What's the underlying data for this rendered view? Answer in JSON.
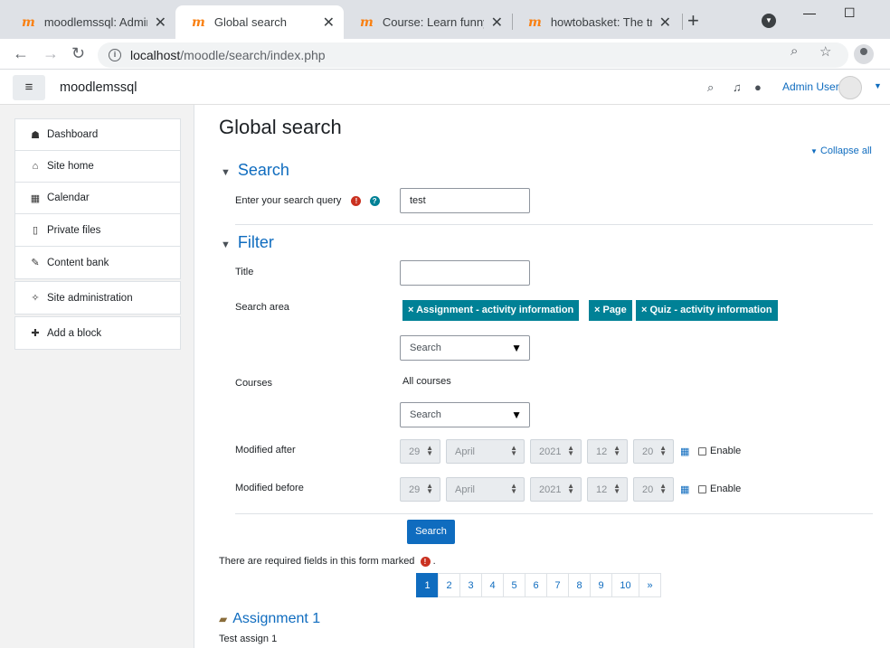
{
  "browser": {
    "tabs": [
      {
        "title": "moodlemssql: Administ",
        "active": false
      },
      {
        "title": "Global search",
        "active": true
      },
      {
        "title": "Course: Learn funny m",
        "active": false
      },
      {
        "title": "howtobasket: The trian",
        "active": false
      }
    ],
    "favicon_glyph": "m",
    "new_tab": "+",
    "url_host": "localhost",
    "url_path": "/moodle/search/index.php",
    "info_glyph": "i"
  },
  "navbar": {
    "site_name": "moodlemssql",
    "hamburger": "≡",
    "user_name": "Admin User"
  },
  "drawer": {
    "groups": [
      {
        "items": [
          {
            "label": "Dashboard",
            "icon": "☗"
          },
          {
            "label": "Site home",
            "icon": "⌂"
          },
          {
            "label": "Calendar",
            "icon": "▦"
          },
          {
            "label": "Private files",
            "icon": "▯"
          }
        ]
      },
      {
        "items": [
          {
            "label": "Content bank",
            "icon": "✎"
          }
        ]
      },
      {
        "items": [
          {
            "label": "Site administration",
            "icon": "✧"
          }
        ]
      },
      {
        "items": [
          {
            "label": "Add a block",
            "icon": "✚"
          }
        ]
      }
    ]
  },
  "main": {
    "title": "Global search",
    "collapse_all": "Collapse all",
    "search_section": {
      "heading": "Search",
      "query_label": "Enter your search query",
      "query_value": "test"
    },
    "filter_section": {
      "heading": "Filter",
      "title_label": "Title",
      "title_value": "",
      "search_area_label": "Search area",
      "search_area_tags": [
        "× Assignment - activity information",
        "× Page",
        "× Quiz - activity information"
      ],
      "search_area_placeholder": "Search",
      "courses_label": "Courses",
      "courses_value": "All courses",
      "courses_placeholder": "Search",
      "modified_after_label": "Modified after",
      "modified_before_label": "Modified before",
      "date_after": {
        "day": "29",
        "month": "April",
        "year": "2021",
        "hour": "12",
        "minute": "20"
      },
      "date_before": {
        "day": "29",
        "month": "April",
        "year": "2021",
        "hour": "12",
        "minute": "20"
      },
      "enable_label": "Enable"
    },
    "submit_label": "Search",
    "required_note": "There are required fields in this form marked",
    "required_note_end": ".",
    "pagination": [
      "1",
      "2",
      "3",
      "4",
      "5",
      "6",
      "7",
      "8",
      "9",
      "10",
      "»"
    ],
    "active_page": "1",
    "result": {
      "title": "Assignment 1",
      "description": "Test assign 1"
    }
  },
  "colors": {
    "primary": "#0f6cbf",
    "tag": "#008196",
    "required": "#ca3120"
  }
}
